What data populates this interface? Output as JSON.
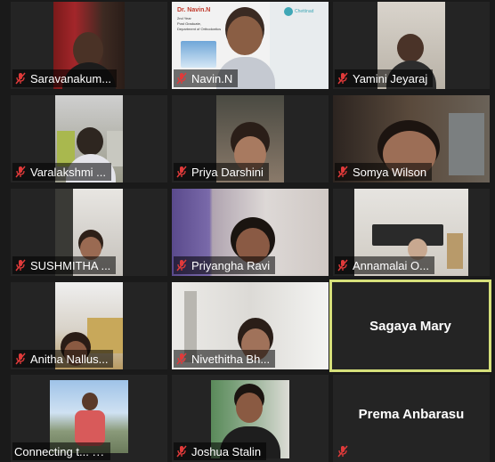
{
  "participants": [
    {
      "name": "Saravanakum...",
      "muted": true
    },
    {
      "name": "Navin.N",
      "muted": true,
      "slide": {
        "title": "Dr. Navin.N",
        "lines": [
          "2nd Year",
          "Post Graduate,",
          "Department of Orthodontics"
        ],
        "logo": "Chettinad"
      }
    },
    {
      "name": "Yamini Jeyaraj",
      "muted": true
    },
    {
      "name": "Varalakshmi ...",
      "muted": true
    },
    {
      "name": "Priya Darshini",
      "muted": true
    },
    {
      "name": "Somya Wilson",
      "muted": true
    },
    {
      "name": "SUSHMITHA ...",
      "muted": true
    },
    {
      "name": "Priyangha Ravi",
      "muted": true
    },
    {
      "name": "Annamalai O...",
      "muted": true
    },
    {
      "name": "Anitha Nallus...",
      "muted": true
    },
    {
      "name": "Nivethitha Bh...",
      "muted": true
    },
    {
      "name": "Sagaya Mary",
      "muted": false,
      "video_off": true,
      "active_speaker": true
    },
    {
      "name": "Connecting t...",
      "muted": false,
      "connecting": true,
      "dots": "..."
    },
    {
      "name": "Joshua Stalin",
      "muted": true
    },
    {
      "name": "Prema Anbarasu",
      "muted": true,
      "video_off": true
    }
  ],
  "colors": {
    "muted_icon": "#e03a3a",
    "active_border": "#d6e07a",
    "tile_bg": "#242424",
    "page_bg": "#1a1a1a"
  }
}
